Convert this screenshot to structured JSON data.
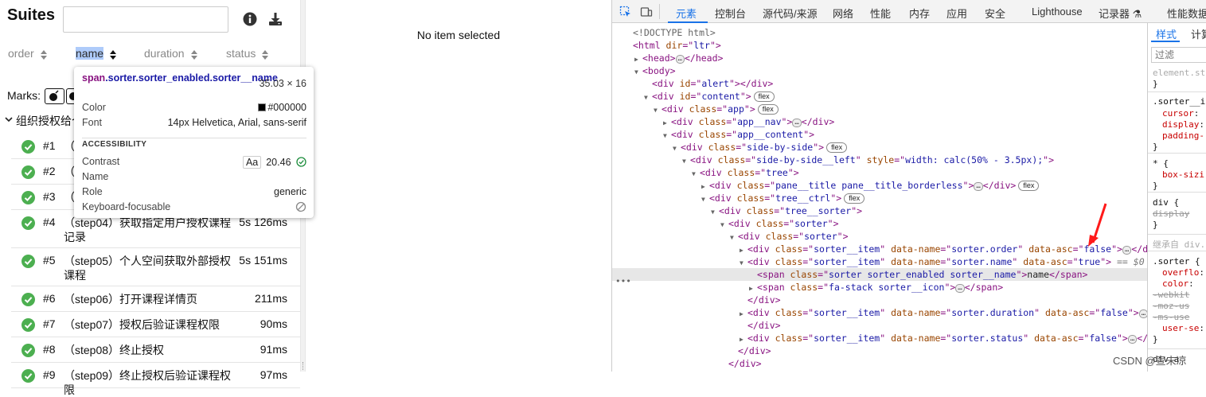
{
  "allure": {
    "title": "Suites",
    "search": {
      "value": "",
      "placeholder": ""
    },
    "info_icon": "info-circle-icon",
    "download_icon": "download-icon",
    "sorters": [
      {
        "label": "order",
        "enabled": false
      },
      {
        "label": "name",
        "enabled": true
      },
      {
        "label": "duration",
        "enabled": false
      },
      {
        "label": "status",
        "enabled": false
      }
    ],
    "marks_label": "Marks:",
    "group_name": "组织授权给个",
    "rows": [
      {
        "num": "#1",
        "name": "（",
        "duration": ""
      },
      {
        "num": "#2",
        "name": "（",
        "duration": ""
      },
      {
        "num": "#3",
        "name": "（",
        "duration": ""
      },
      {
        "num": "#4",
        "name": "（step04）获取指定用户授权课程记录",
        "duration": "5s 126ms"
      },
      {
        "num": "#5",
        "name": "（step05）个人空间获取外部授权课程",
        "duration": "5s 151ms"
      },
      {
        "num": "#6",
        "name": "（step06）打开课程详情页",
        "duration": "211ms"
      },
      {
        "num": "#7",
        "name": "（step07）授权后验证课程权限",
        "duration": "90ms"
      },
      {
        "num": "#8",
        "name": "（step08）终止授权",
        "duration": "91ms"
      },
      {
        "num": "#9",
        "name": "（step09）终止授权后验证课程权限",
        "duration": "97ms"
      }
    ],
    "status_color": "#4caf50",
    "detail_empty": "No item selected"
  },
  "tooltip": {
    "selector_tag": "span",
    "selector_class": ".sorter.sorter_enabled.sorter__name",
    "dimensions": "35.03 × 16",
    "color_label": "Color",
    "color_value": "#000000",
    "font_label": "Font",
    "font_value": "14px Helvetica, Arial, sans-serif",
    "accessibility_heading": "ACCESSIBILITY",
    "contrast_label": "Contrast",
    "contrast_aa": "Aa",
    "contrast_value": "20.46",
    "name_label": "Name",
    "role_label": "Role",
    "role_value": "generic",
    "focus_label": "Keyboard-focusable"
  },
  "devtools": {
    "tabs": [
      "元素",
      "控制台",
      "源代码/来源",
      "网络",
      "性能",
      "内存",
      "应用",
      "安全",
      "Lighthouse",
      "记录器 ⚗",
      "性能数据"
    ],
    "active_tab": "元素",
    "dom": [
      {
        "indent": 0,
        "tri": "",
        "parts": [
          [
            "cm",
            "<!DOCTYPE html>"
          ]
        ]
      },
      {
        "indent": 0,
        "tri": "",
        "parts": [
          [
            "t",
            "<html "
          ],
          [
            "an",
            "dir"
          ],
          [
            "t",
            "=\""
          ],
          [
            "av",
            "ltr"
          ],
          [
            "t",
            "\">"
          ]
        ]
      },
      {
        "indent": 1,
        "tri": "▶",
        "parts": [
          [
            "t",
            "<head>"
          ],
          [
            "ell",
            "…"
          ],
          [
            "t",
            "</head>"
          ]
        ]
      },
      {
        "indent": 1,
        "tri": "▼",
        "parts": [
          [
            "t",
            "<body>"
          ]
        ]
      },
      {
        "indent": 2,
        "tri": "",
        "parts": [
          [
            "t",
            "<div "
          ],
          [
            "an",
            "id"
          ],
          [
            "t",
            "=\""
          ],
          [
            "av",
            "alert"
          ],
          [
            "t",
            "\"></div>"
          ]
        ]
      },
      {
        "indent": 2,
        "tri": "▼",
        "parts": [
          [
            "t",
            "<div "
          ],
          [
            "an",
            "id"
          ],
          [
            "t",
            "=\""
          ],
          [
            "av",
            "content"
          ],
          [
            "t",
            "\">"
          ],
          [
            "badge",
            "flex"
          ]
        ]
      },
      {
        "indent": 3,
        "tri": "▼",
        "parts": [
          [
            "t",
            "<div "
          ],
          [
            "an",
            "class"
          ],
          [
            "t",
            "=\""
          ],
          [
            "av",
            "app"
          ],
          [
            "t",
            "\">"
          ],
          [
            "badge",
            "flex"
          ]
        ]
      },
      {
        "indent": 4,
        "tri": "▶",
        "parts": [
          [
            "t",
            "<div "
          ],
          [
            "an",
            "class"
          ],
          [
            "t",
            "=\""
          ],
          [
            "av",
            "app__nav"
          ],
          [
            "t",
            "\">"
          ],
          [
            "ell",
            "…"
          ],
          [
            "t",
            "</div>"
          ]
        ]
      },
      {
        "indent": 4,
        "tri": "▼",
        "parts": [
          [
            "t",
            "<div "
          ],
          [
            "an",
            "class"
          ],
          [
            "t",
            "=\""
          ],
          [
            "av",
            "app__content"
          ],
          [
            "t",
            "\">"
          ]
        ]
      },
      {
        "indent": 5,
        "tri": "▼",
        "parts": [
          [
            "t",
            "<div "
          ],
          [
            "an",
            "class"
          ],
          [
            "t",
            "=\""
          ],
          [
            "av",
            "side-by-side"
          ],
          [
            "t",
            "\">"
          ],
          [
            "badge",
            "flex"
          ]
        ]
      },
      {
        "indent": 6,
        "tri": "▼",
        "parts": [
          [
            "t",
            "<div "
          ],
          [
            "an",
            "class"
          ],
          [
            "t",
            "=\""
          ],
          [
            "av",
            "side-by-side__left"
          ],
          [
            "t",
            "\" "
          ],
          [
            "an",
            "style"
          ],
          [
            "t",
            "=\""
          ],
          [
            "av",
            "width: calc(50% - 3.5px);"
          ],
          [
            "t",
            "\">"
          ]
        ]
      },
      {
        "indent": 7,
        "tri": "▼",
        "parts": [
          [
            "t",
            "<div "
          ],
          [
            "an",
            "class"
          ],
          [
            "t",
            "=\""
          ],
          [
            "av",
            "tree"
          ],
          [
            "t",
            "\">"
          ]
        ]
      },
      {
        "indent": 8,
        "tri": "▶",
        "parts": [
          [
            "t",
            "<div "
          ],
          [
            "an",
            "class"
          ],
          [
            "t",
            "=\""
          ],
          [
            "av",
            "pane__title pane__title_borderless"
          ],
          [
            "t",
            "\">"
          ],
          [
            "ell",
            "…"
          ],
          [
            "t",
            "</div>"
          ],
          [
            "badge",
            "flex"
          ]
        ]
      },
      {
        "indent": 8,
        "tri": "▼",
        "parts": [
          [
            "t",
            "<div "
          ],
          [
            "an",
            "class"
          ],
          [
            "t",
            "=\""
          ],
          [
            "av",
            "tree__ctrl"
          ],
          [
            "t",
            "\">"
          ],
          [
            "badge",
            "flex"
          ]
        ]
      },
      {
        "indent": 9,
        "tri": "▼",
        "parts": [
          [
            "t",
            "<div "
          ],
          [
            "an",
            "class"
          ],
          [
            "t",
            "=\""
          ],
          [
            "av",
            "tree__sorter"
          ],
          [
            "t",
            "\">"
          ]
        ]
      },
      {
        "indent": 10,
        "tri": "▼",
        "parts": [
          [
            "t",
            "<div "
          ],
          [
            "an",
            "class"
          ],
          [
            "t",
            "=\""
          ],
          [
            "av",
            "sorter"
          ],
          [
            "t",
            "\">"
          ]
        ]
      },
      {
        "indent": 11,
        "tri": "▼",
        "parts": [
          [
            "t",
            "<div "
          ],
          [
            "an",
            "class"
          ],
          [
            "t",
            "=\""
          ],
          [
            "av",
            "sorter"
          ],
          [
            "t",
            "\">"
          ]
        ]
      },
      {
        "indent": 12,
        "tri": "▶",
        "parts": [
          [
            "t",
            "<div "
          ],
          [
            "an",
            "class"
          ],
          [
            "t",
            "=\""
          ],
          [
            "av",
            "sorter__item"
          ],
          [
            "t",
            "\" "
          ],
          [
            "an",
            "data-name"
          ],
          [
            "t",
            "=\""
          ],
          [
            "av",
            "sorter.order"
          ],
          [
            "t",
            "\" "
          ],
          [
            "an",
            "data-asc"
          ],
          [
            "t",
            "=\""
          ],
          [
            "av",
            "false"
          ],
          [
            "t",
            "\">"
          ],
          [
            "ell",
            "…"
          ],
          [
            "t",
            "</div>"
          ]
        ]
      },
      {
        "indent": 12,
        "tri": "▼",
        "parts": [
          [
            "t",
            "<div "
          ],
          [
            "an",
            "class"
          ],
          [
            "t",
            "=\""
          ],
          [
            "av",
            "sorter__item"
          ],
          [
            "t",
            "\" "
          ],
          [
            "an",
            "data-name"
          ],
          [
            "t",
            "=\""
          ],
          [
            "av",
            "sorter.name"
          ],
          [
            "t",
            "\" "
          ],
          [
            "an",
            "data-asc"
          ],
          [
            "t",
            "=\""
          ],
          [
            "av",
            "true"
          ],
          [
            "t",
            "\">"
          ],
          [
            "dollar",
            " == $0"
          ]
        ]
      },
      {
        "indent": 13,
        "tri": "",
        "selected": true,
        "parts": [
          [
            "t",
            "<span "
          ],
          [
            "an",
            "class"
          ],
          [
            "t",
            "=\""
          ],
          [
            "av",
            "sorter sorter_enabled sorter__name"
          ],
          [
            "t",
            "\">"
          ],
          [
            "tx",
            "name"
          ],
          [
            "t",
            "</span>"
          ]
        ]
      },
      {
        "indent": 13,
        "tri": "▶",
        "parts": [
          [
            "t",
            "<span "
          ],
          [
            "an",
            "class"
          ],
          [
            "t",
            "=\""
          ],
          [
            "av",
            "fa-stack sorter__icon"
          ],
          [
            "t",
            "\">"
          ],
          [
            "ell",
            "…"
          ],
          [
            "t",
            "</span>"
          ]
        ]
      },
      {
        "indent": 12,
        "tri": "",
        "parts": [
          [
            "t",
            "</div>"
          ]
        ]
      },
      {
        "indent": 12,
        "tri": "▶",
        "parts": [
          [
            "t",
            "<div "
          ],
          [
            "an",
            "class"
          ],
          [
            "t",
            "=\""
          ],
          [
            "av",
            "sorter__item"
          ],
          [
            "t",
            "\" "
          ],
          [
            "an",
            "data-name"
          ],
          [
            "t",
            "=\""
          ],
          [
            "av",
            "sorter.duration"
          ],
          [
            "t",
            "\" "
          ],
          [
            "an",
            "data-asc"
          ],
          [
            "t",
            "=\""
          ],
          [
            "av",
            "false"
          ],
          [
            "t",
            "\">"
          ],
          [
            "ell",
            "…"
          ]
        ]
      },
      {
        "indent": 12,
        "tri": "",
        "parts": [
          [
            "t",
            "</div>"
          ]
        ]
      },
      {
        "indent": 12,
        "tri": "▶",
        "parts": [
          [
            "t",
            "<div "
          ],
          [
            "an",
            "class"
          ],
          [
            "t",
            "=\""
          ],
          [
            "av",
            "sorter__item"
          ],
          [
            "t",
            "\" "
          ],
          [
            "an",
            "data-name"
          ],
          [
            "t",
            "=\""
          ],
          [
            "av",
            "sorter.status"
          ],
          [
            "t",
            "\" "
          ],
          [
            "an",
            "data-asc"
          ],
          [
            "t",
            "=\""
          ],
          [
            "av",
            "false"
          ],
          [
            "t",
            "\">"
          ],
          [
            "ell",
            "…"
          ],
          [
            "t",
            "</div>"
          ]
        ]
      },
      {
        "indent": 11,
        "tri": "",
        "parts": [
          [
            "t",
            "</div>"
          ]
        ]
      },
      {
        "indent": 10,
        "tri": "",
        "parts": [
          [
            "t",
            "</div>"
          ]
        ]
      },
      {
        "indent": 9,
        "tri": "",
        "parts": [
          [
            "t",
            "</div>"
          ]
        ]
      }
    ],
    "styles": {
      "tabs": [
        "样式",
        "计算"
      ],
      "filter_placeholder": "过滤",
      "lines": [
        {
          "kind": "dim",
          "text": "element.st"
        },
        {
          "kind": "plain",
          "text": "}"
        },
        {
          "kind": "plain",
          "text": ".sorter__i"
        },
        {
          "kind": "prop",
          "name": "cursor",
          "value": ""
        },
        {
          "kind": "prop",
          "name": "display",
          "value": ""
        },
        {
          "kind": "prop",
          "name": "padding-",
          "value": ""
        },
        {
          "kind": "plain",
          "text": "}"
        },
        {
          "kind": "plain",
          "text": "* {"
        },
        {
          "kind": "prop",
          "name": "box-sizi",
          "value": ""
        },
        {
          "kind": "plain",
          "text": "}"
        },
        {
          "kind": "plain",
          "text": "div {"
        },
        {
          "kind": "strike",
          "text": "display"
        },
        {
          "kind": "plain",
          "text": "}"
        },
        {
          "kind": "dim",
          "text": "继承自 div."
        },
        {
          "kind": "plain",
          "text": ".sorter {"
        },
        {
          "kind": "prop",
          "name": "overflo",
          "value": ""
        },
        {
          "kind": "prop",
          "name": "color",
          "value": ""
        },
        {
          "kind": "strike",
          "text": "-webkit"
        },
        {
          "kind": "strike",
          "text": "-moz-us"
        },
        {
          "kind": "strike",
          "text": "-ms-use"
        },
        {
          "kind": "prop",
          "name": "user-se",
          "value": ""
        },
        {
          "kind": "plain",
          "text": "}"
        },
        {
          "kind": "plain",
          "text": "div.a"
        }
      ]
    }
  },
  "watermark": "CSDN @宣未凉"
}
